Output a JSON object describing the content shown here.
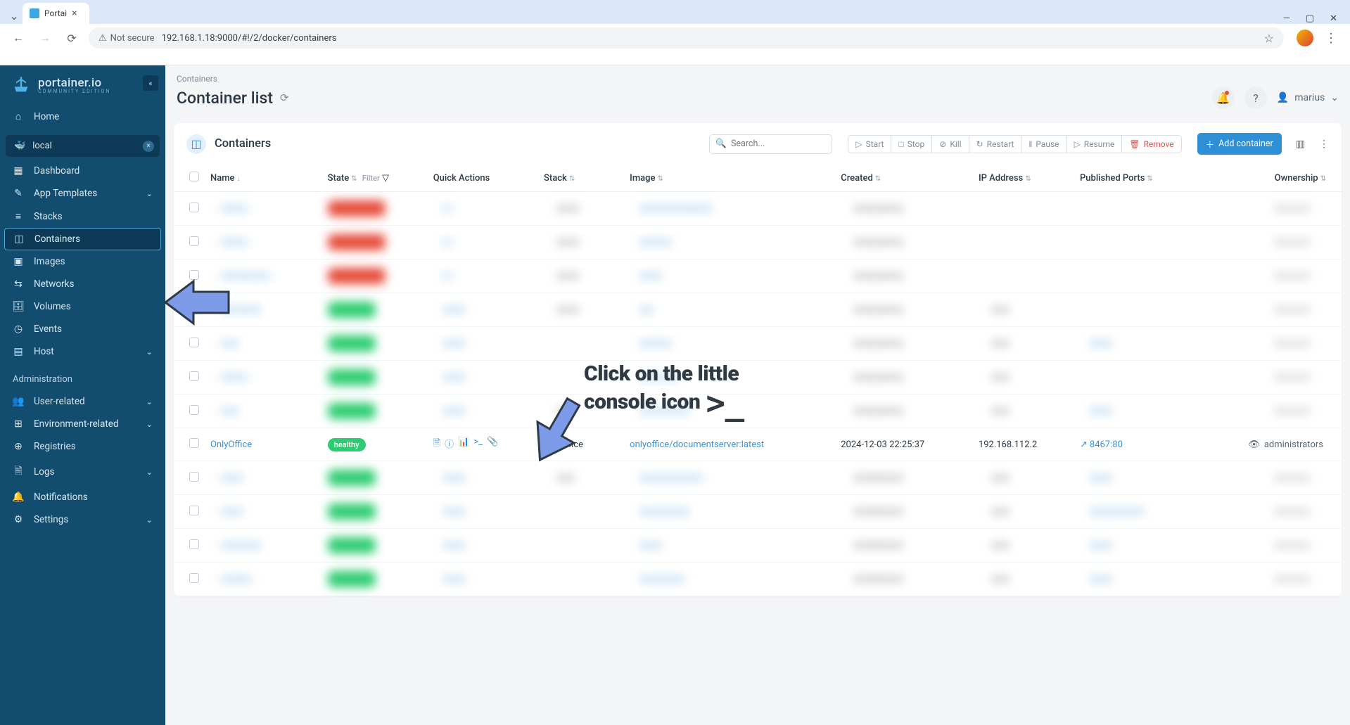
{
  "browser": {
    "tab_title": "Portai",
    "not_secure": "Not secure",
    "url": "192.168.1.18:9000/#!/2/docker/containers"
  },
  "sidebar": {
    "brand": "portainer.io",
    "brand_sub": "COMMUNITY EDITION",
    "home": "Home",
    "env_name": "local",
    "items": {
      "dashboard": "Dashboard",
      "templates": "App Templates",
      "stacks": "Stacks",
      "containers": "Containers",
      "images": "Images",
      "networks": "Networks",
      "volumes": "Volumes",
      "events": "Events",
      "host": "Host"
    },
    "admin_title": "Administration",
    "admin": {
      "user_related": "User-related",
      "env_related": "Environment-related",
      "registries": "Registries",
      "logs": "Logs",
      "notifications": "Notifications",
      "settings": "Settings"
    }
  },
  "header": {
    "breadcrumb": "Containers",
    "title": "Container list",
    "user": "marius"
  },
  "panel": {
    "title": "Containers",
    "search_placeholder": "Search...",
    "actions": {
      "start": "Start",
      "stop": "Stop",
      "kill": "Kill",
      "restart": "Restart",
      "pause": "Pause",
      "resume": "Resume",
      "remove": "Remove"
    },
    "add": "Add container"
  },
  "columns": {
    "name": "Name",
    "state": "State",
    "filter": "Filter",
    "quick": "Quick Actions",
    "stack": "Stack",
    "image": "Image",
    "created": "Created",
    "ip": "IP Address",
    "ports": "Published Ports",
    "ownership": "Ownership"
  },
  "visible_row": {
    "name": "OnlyOffice",
    "state": "healthy",
    "stack": "onlyoffice",
    "image": "onlyoffice/documentserver:latest",
    "created": "2024-12-03 22:25:37",
    "ip": "192.168.112.2",
    "port": "8467:80",
    "ownership": "administrators"
  },
  "annotation": {
    "text_line1": "Click on the little",
    "text_line2": "console icon"
  }
}
